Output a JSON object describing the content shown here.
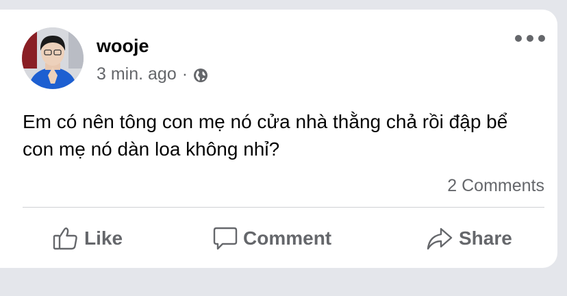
{
  "post": {
    "author": "wooje",
    "timestamp": "3 min. ago",
    "separator": "·",
    "privacy_icon": "globe-icon",
    "more_icon": "more-options-icon",
    "text": "Em có nên tông con mẹ nó cửa nhà thằng chả rồi đập bể con mẹ nó dàn loa không nhỉ?",
    "comments_count": "2 Comments"
  },
  "actions": {
    "like": {
      "label": "Like",
      "icon": "thumbs-up-icon"
    },
    "comment": {
      "label": "Comment",
      "icon": "comment-bubble-icon"
    },
    "share": {
      "label": "Share",
      "icon": "share-arrow-icon"
    }
  },
  "colors": {
    "background": "#e4e6eb",
    "card": "#ffffff",
    "primary_text": "#050505",
    "secondary_text": "#65676b",
    "divider": "#ced0d4",
    "avatar_shirt": "#1d5fd1"
  }
}
